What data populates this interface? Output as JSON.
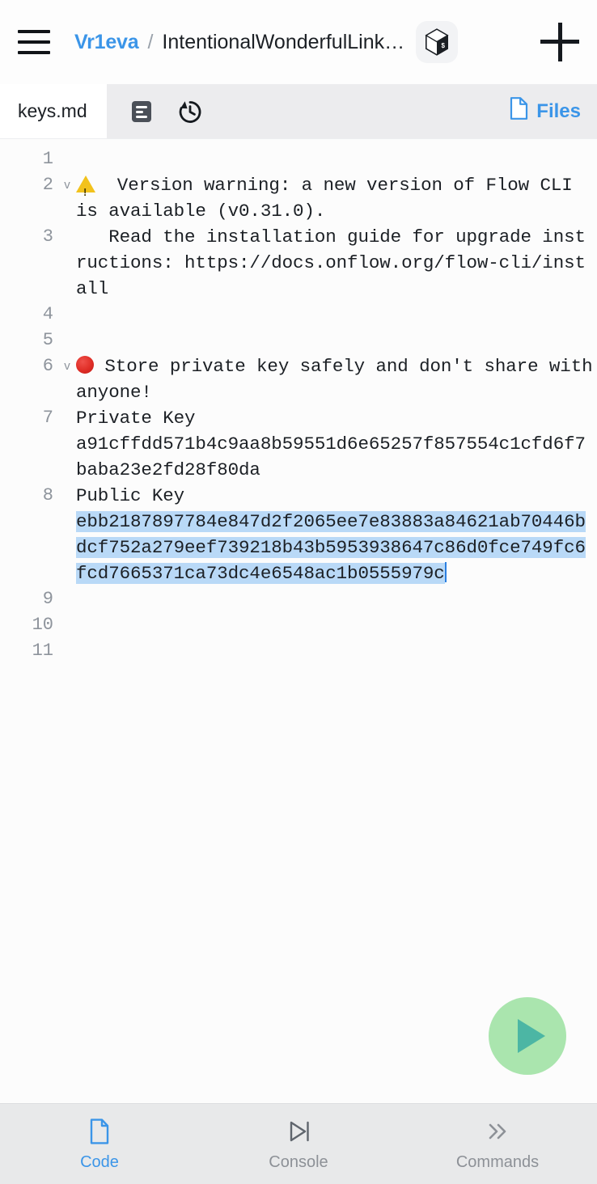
{
  "topbar": {
    "menu_icon": "hamburger-menu-icon",
    "owner": "Vr1eva",
    "separator": "/",
    "project": "IntentionalWonderfulLinked...",
    "project_badge_icon": "flow-cube-icon",
    "add_icon": "plus-icon"
  },
  "tabbar": {
    "file_name": "keys.md",
    "format_icon": "document-format-icon",
    "history_icon": "history-clock-icon",
    "files_label": "Files",
    "files_icon": "file-icon"
  },
  "editor": {
    "lines": [
      {
        "number": "1",
        "fold": "",
        "segments": []
      },
      {
        "number": "2",
        "fold": "v",
        "segments": [
          {
            "kind": "warning-emoji",
            "text": ""
          },
          {
            "kind": "text",
            "text": "  Version warning: a new version of Flow CLI is available (v0.31.0)."
          }
        ]
      },
      {
        "number": "3",
        "fold": "",
        "segments": [
          {
            "kind": "text",
            "text": "   Read the installation guide for upgrade instructions: https://docs.onflow.org/flow-cli/install"
          }
        ]
      },
      {
        "number": "4",
        "fold": "",
        "segments": []
      },
      {
        "number": "5",
        "fold": "",
        "segments": []
      },
      {
        "number": "6",
        "fold": "v",
        "segments": [
          {
            "kind": "red-dot-emoji",
            "text": ""
          },
          {
            "kind": "text",
            "text": " Store private key safely and don't share with anyone!"
          }
        ]
      },
      {
        "number": "7",
        "fold": "",
        "segments": [
          {
            "kind": "text",
            "text": "Private Key\na91cffdd571b4c9aa8b59551d6e65257f857554c1cfd6f7baba23e2fd28f80da"
          }
        ]
      },
      {
        "number": "8",
        "fold": "",
        "segments": [
          {
            "kind": "text",
            "text": "Public Key\n"
          },
          {
            "kind": "selected",
            "text": "ebb2187897784e847d2f2065ee7e83883a84621ab70446bdcf752a279eef739218b43b5953938647c86d0fce749fc6fcd7665371ca73dc4e6548ac1b0555979c"
          },
          {
            "kind": "caret",
            "text": ""
          }
        ]
      },
      {
        "number": "9",
        "fold": "",
        "segments": []
      },
      {
        "number": "10",
        "fold": "",
        "segments": []
      },
      {
        "number": "11",
        "fold": "",
        "segments": []
      }
    ],
    "run_button_icon": "play-triangle-icon"
  },
  "bottomnav": {
    "items": [
      {
        "label": "Code",
        "icon": "file-code-icon",
        "active": true
      },
      {
        "label": "Console",
        "icon": "play-to-end-icon",
        "active": false
      },
      {
        "label": "Commands",
        "icon": "double-chevron-right-icon",
        "active": false
      }
    ]
  },
  "colors": {
    "accent_blue": "#3b95e8",
    "selection_blue": "#b9d9f7",
    "run_green_bg": "#aae5ae",
    "run_green_fg": "#4cb6a4",
    "warning_yellow": "#f2c21c",
    "alert_red": "#df2d26"
  }
}
